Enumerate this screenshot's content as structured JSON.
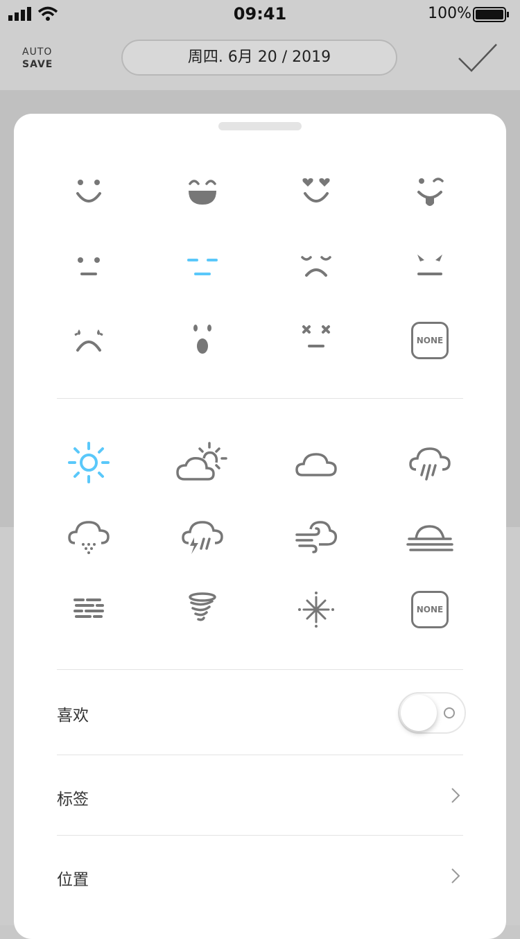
{
  "status": {
    "time": "09:41",
    "battery": "100%"
  },
  "nav": {
    "autosave_line1": "AUTO",
    "autosave_line2": "SAVE",
    "date": "周四. 6月 20 / 2019"
  },
  "mood_icons": [
    "happy-face",
    "laughing-face",
    "heart-eyes-face",
    "tongue-wink-face",
    "neutral-face",
    "sleepy-face",
    "sad-tired-face",
    "angry-face",
    "crying-face",
    "surprised-face",
    "dead-face",
    "none"
  ],
  "weather_icons": [
    "sun",
    "partly-cloudy",
    "cloud",
    "rain",
    "snow",
    "thunderstorm",
    "wind",
    "fog",
    "haze",
    "tornado",
    "snowflake",
    "none"
  ],
  "none_label": "NONE",
  "selected_mood": "sleepy-face",
  "selected_weather": "sun",
  "colors": {
    "accent": "#5ac8fa",
    "icon": "#777777"
  },
  "rows": {
    "like_label": "喜欢",
    "tags_label": "标签",
    "location_label": "位置"
  },
  "like_enabled": false
}
